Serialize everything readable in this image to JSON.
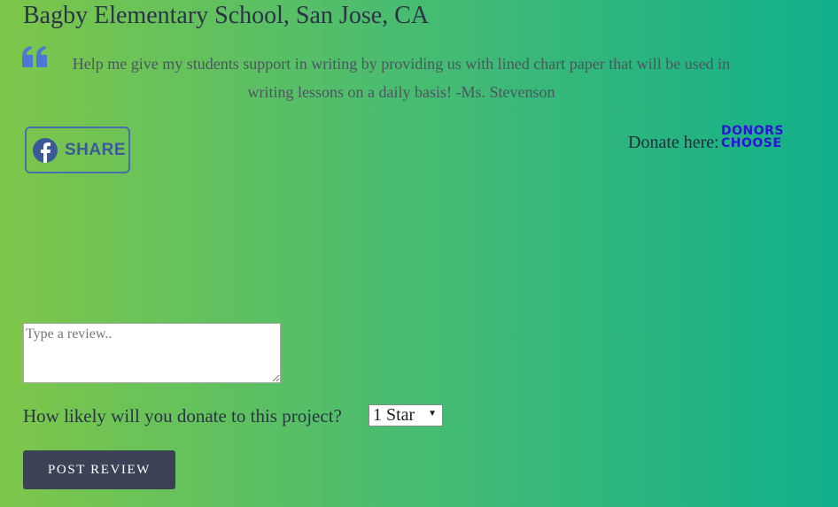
{
  "school": {
    "title": "Bagby Elementary School, San Jose, CA"
  },
  "quote": {
    "icon": "quote-icon",
    "text": "Help me give my students support in writing by providing us with lined chart paper that will be used in writing lessons on a daily basis! -Ms. Stevenson"
  },
  "share": {
    "label": "SHARE",
    "icon": "facebook-icon"
  },
  "donate": {
    "label": "Donate here:",
    "logo_line1": "DONORS",
    "logo_line2": "CHOOSE"
  },
  "review": {
    "placeholder": "Type a review.."
  },
  "rating": {
    "question": "How likely will you donate to this project?",
    "selected": "1 Star"
  },
  "post": {
    "label": "POST REVIEW"
  },
  "colors": {
    "bg_left": "#7ec64a",
    "bg_right": "#11b08b",
    "quote_icon": "#4a78d4",
    "facebook": "#3d5a98",
    "donorschoose": "#2c13d6",
    "button": "#3b4256"
  }
}
